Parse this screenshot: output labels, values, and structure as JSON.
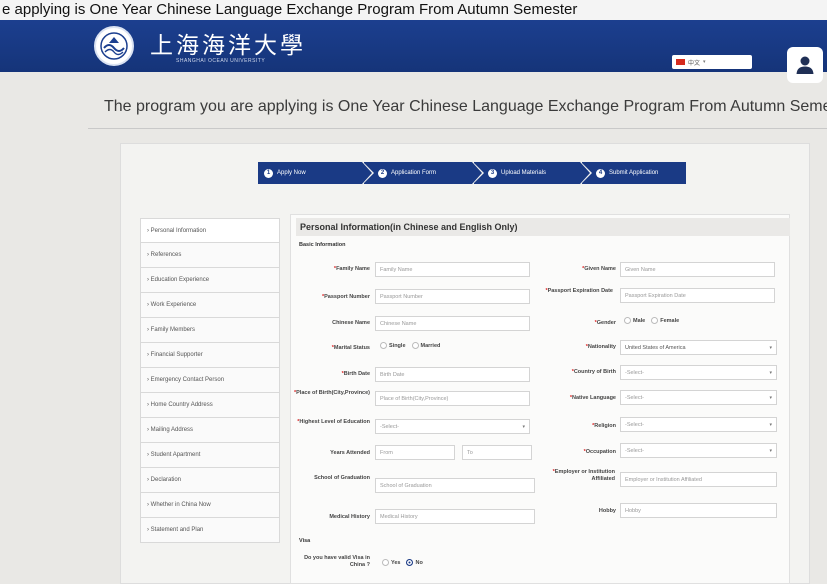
{
  "top_strip": {
    "text": "e applying is One Year Chinese Language Exchange Program From Autumn Semester"
  },
  "header": {
    "brand_cn": "上海海洋大學",
    "brand_en": "SHANGHAI OCEAN UNIVERSITY",
    "language": "中文",
    "colors": {
      "navbar": "#1c3f8f",
      "accent": "#1a3a85"
    }
  },
  "program_title": "The program you are applying is One Year Chinese Language Exchange Program From Autumn Semester",
  "steps": [
    {
      "num": "1",
      "label": "Apply Now"
    },
    {
      "num": "2",
      "label": "Application Form"
    },
    {
      "num": "3",
      "label": "Upload Materials"
    },
    {
      "num": "4",
      "label": "Submit Application"
    }
  ],
  "sidebar": [
    "Personal Information",
    "References",
    "Education Experience",
    "Work Experience",
    "Family Members",
    "Financial Supporter",
    "Emergency Contact Person",
    "Home Country Address",
    "Mailing Address",
    "Student Apartment",
    "Declaration",
    "Whether in China Now",
    "Statement and Plan"
  ],
  "form": {
    "title": "Personal Information(in Chinese and English Only)",
    "basic_info": "Basic Information",
    "family_name": {
      "label": "Family Name",
      "placeholder": "Family Name"
    },
    "given_name": {
      "label": "Given Name",
      "placeholder": "Given Name"
    },
    "passport_number": {
      "label": "Passport Number",
      "placeholder": "Passport Number"
    },
    "passport_expiration": {
      "label": "Passport Expiration Date",
      "placeholder": "Passport Expiration Date"
    },
    "chinese_name": {
      "label": "Chinese Name",
      "placeholder": "Chinese Name"
    },
    "gender": {
      "label": "Gender",
      "options": [
        "Male",
        "Female"
      ]
    },
    "marital_status": {
      "label": "Marital Status",
      "options": [
        "Single",
        "Married"
      ]
    },
    "nationality": {
      "label": "Nationality",
      "value": "United States of America"
    },
    "birth_date": {
      "label": "Birth Date",
      "placeholder": "Birth Date"
    },
    "country_of_birth": {
      "label": "Country of Birth",
      "value": "-Select-"
    },
    "place_of_birth": {
      "label": "Place of Birth(City,Province)",
      "placeholder": "Place of Birth(City,Province)"
    },
    "native_language": {
      "label": "Native Language",
      "value": "-Select-"
    },
    "highest_education": {
      "label": "Highest Level of Education",
      "value": "-Select-"
    },
    "religion": {
      "label": "Religion",
      "value": "-Select-"
    },
    "years_attended": {
      "label": "Years Attended",
      "from": "From",
      "to": "To"
    },
    "occupation": {
      "label": "Occupation",
      "value": "-Select-"
    },
    "school_of_graduation": {
      "label": "School of Graduation",
      "placeholder": "School of Graduation"
    },
    "employer": {
      "label": "Employer or Institution Affiliated",
      "placeholder": "Employer or Institution Affiliated"
    },
    "medical_history": {
      "label": "Medical History",
      "placeholder": "Medical History"
    },
    "hobby": {
      "label": "Hobby",
      "placeholder": "Hobby"
    },
    "visa_section": "Visa",
    "visa_question": {
      "label": "Do you have valid Visa in China ?",
      "options": [
        "Yes",
        "No"
      ],
      "selected": "No"
    }
  }
}
